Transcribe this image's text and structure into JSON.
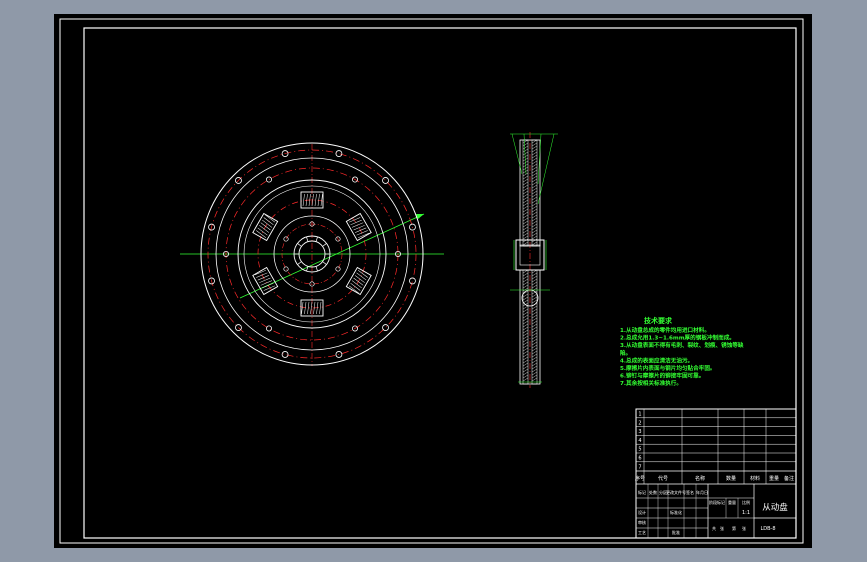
{
  "drawing": {
    "colors": {
      "background": "#8f99a8",
      "paper": "#000000",
      "outline": "#ffffff",
      "center_line": "#ff2a2a",
      "annotation": "#33ff33"
    },
    "tech_requirements": {
      "title": "技术要求",
      "items": [
        "1.从动盘总成的零件均用进口材料。",
        "2.总成允用1.3~1.6mm厚的钢板冲制而成。",
        "3.从动盘表面不得有毛刺、裂纹、划痕、锈蚀等缺",
        "陷。",
        "4.总成的表面应清洁无油污。",
        "5.摩擦片内表面与钢片均匀贴合牢固。",
        "6.铆钉与摩擦片的铆接牢固可靠。",
        "7.其余按相关标准执行。"
      ]
    },
    "title_block": {
      "part_name": "从动盘",
      "drawing_no": "LDB-8",
      "scale": "1:1",
      "header_cells": [
        "序号",
        "代号",
        "名称",
        "数量",
        "材料",
        "重量",
        "备注"
      ],
      "signature_cells": [
        "标记",
        "处数",
        "分区",
        "更改文件号",
        "签名",
        "年月日",
        "设计",
        "标准化",
        "审核",
        "工艺",
        "批准"
      ],
      "stage_cells": [
        "阶段标记",
        "重量",
        "比例"
      ],
      "sheet_cells": [
        "共",
        "张",
        "第",
        "张"
      ],
      "rows": [
        {
          "no": "1",
          "code": "",
          "name": "",
          "qty": "",
          "material": ""
        },
        {
          "no": "2",
          "code": "",
          "name": "",
          "qty": "",
          "material": ""
        },
        {
          "no": "3",
          "code": "",
          "name": "",
          "qty": "",
          "material": ""
        },
        {
          "no": "4",
          "code": "",
          "name": "",
          "qty": "",
          "material": ""
        },
        {
          "no": "5",
          "code": "",
          "name": "",
          "qty": "",
          "material": ""
        },
        {
          "no": "6",
          "code": "",
          "name": "",
          "qty": "",
          "material": ""
        },
        {
          "no": "7",
          "code": "",
          "name": "",
          "qty": "",
          "material": ""
        }
      ]
    }
  }
}
